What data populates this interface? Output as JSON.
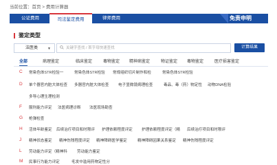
{
  "breadcrumb": {
    "prefix": "当前位置：",
    "home": "首页",
    "sep": " > ",
    "current": "费用计算器"
  },
  "nav": {
    "tabs": [
      "公证费用",
      "司法鉴定费用",
      "律师费用"
    ],
    "active_index": 1,
    "right_label": "免责申明"
  },
  "section_title": "鉴定类型",
  "search": {
    "select_value": "法医类",
    "placeholder": "关键字查找 / 首字母快速查找",
    "button_label": "计算结果"
  },
  "letters": [
    "全部",
    "病理鉴定",
    "临床鉴定",
    "毒物鉴定",
    "精神病鉴定",
    "物证鉴定",
    "毒物鉴定",
    "医疗损害鉴定"
  ],
  "categories": [
    {
      "letter": "C",
      "items": [
        "常染色体STR检验一",
        "常染色体STR检验",
        "常规组织切片制作和检",
        "常染色体STR检验"
      ]
    },
    {
      "letter": "D",
      "items": [
        "单个器官内脏大体检查",
        "多器官内脏大体检查",
        "电子显微镜病理检查",
        "毒品、毒（药）物定性",
        "动物DNA检验"
      ]
    },
    {
      "letter": "",
      "items": [
        "多导心理生理检测"
      ]
    },
    {
      "letter": "F",
      "items": [
        "服刑能力评定",
        "法医病理诊断",
        "法医现场勘查"
      ]
    },
    {
      "letter": "G",
      "items": [
        "枪弹检查"
      ]
    },
    {
      "letter": "H",
      "items": [
        "活体年龄鉴定",
        "后续治疗项目和时限评",
        "护理依赖程度评定",
        "护理依赖程度评定（精",
        "后续治疗项目和时限评"
      ]
    },
    {
      "letter": "J",
      "items": [
        "精神状态鉴定",
        "精神伤残程度评定",
        "精神障碍医学鉴定",
        "精神障碍因果关系鉴定",
        "精神伤残程度评定"
      ]
    },
    {
      "letter": "L",
      "items": [
        "劳动能力评定（精神科",
        "劳动能力鉴定"
      ]
    },
    {
      "letter": "M",
      "items": [
        "民事行为能力评定",
        "毛发中滥用药物定性分"
      ]
    }
  ]
}
